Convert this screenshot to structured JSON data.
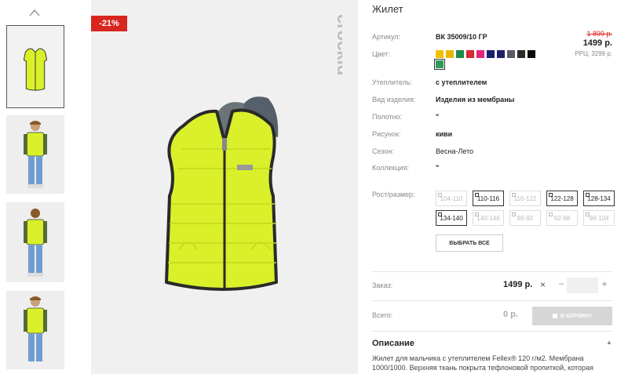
{
  "product": {
    "title": "Жилет",
    "discount_badge": "-21%",
    "brand": "crockid"
  },
  "pricing": {
    "old_price": "1 899 р.",
    "new_price": "1499 р.",
    "rrc": "РРЦ: 3299 р."
  },
  "attributes": [
    {
      "label": "Артикул:",
      "value": "ВК 35009/10 ГР"
    },
    {
      "label": "Цвет:",
      "value": ""
    },
    {
      "label": "Утеплитель:",
      "value": "с утеплителем"
    },
    {
      "label": "Вид изделия:",
      "value": "Изделия из мембраны"
    },
    {
      "label": "Полотно:",
      "value": "\""
    },
    {
      "label": "Рисунок:",
      "value": "киви"
    },
    {
      "label": "Сезон:",
      "value": "Весна-Лето"
    },
    {
      "label": "Коллекция:",
      "value": "\""
    },
    {
      "label": "Рост/размер:",
      "value": ""
    }
  ],
  "colors": [
    "#f2c200",
    "#e8b800",
    "#1e8a4e",
    "#d62a35",
    "#e3267a",
    "#1a1f6e",
    "#20206a",
    "#5a5a66",
    "#2a2a2a",
    "#0a0a0a",
    "#2e9a5a"
  ],
  "selected_color_index": 10,
  "sizes": [
    {
      "label": "104-110",
      "available": false
    },
    {
      "label": "110-116",
      "available": true
    },
    {
      "label": "116-122",
      "available": false
    },
    {
      "label": "122-128",
      "available": true
    },
    {
      "label": "128-134",
      "available": true
    },
    {
      "label": "134-140",
      "available": true
    },
    {
      "label": "140-146",
      "available": false
    },
    {
      "label": "86-92",
      "available": false
    },
    {
      "label": "92-98",
      "available": false
    },
    {
      "label": "98-104",
      "available": false
    }
  ],
  "select_all_label": "ВЫБРАТЬ ВСЕ",
  "order": {
    "label": "Заказ:",
    "price": "1499 р.",
    "times": "×",
    "minus": "−",
    "plus": "+",
    "qty": ""
  },
  "total": {
    "label": "Всего:",
    "value": "0 р.",
    "cart_button": "В КОРЗИНУ"
  },
  "description": {
    "title": "Описание",
    "toggle": "▲",
    "text": "Жилет для мальчика с утеплителем Fellex® 120 г/м2. Мембрана 1000/1000. Верхняя ткань покрыта тефлоновой пропиткой, которая"
  },
  "thumbnail_icons": [
    "vest-thumbnail",
    "boy-front-thumbnail",
    "boy-back-thumbnail",
    "boy-side-thumbnail"
  ]
}
